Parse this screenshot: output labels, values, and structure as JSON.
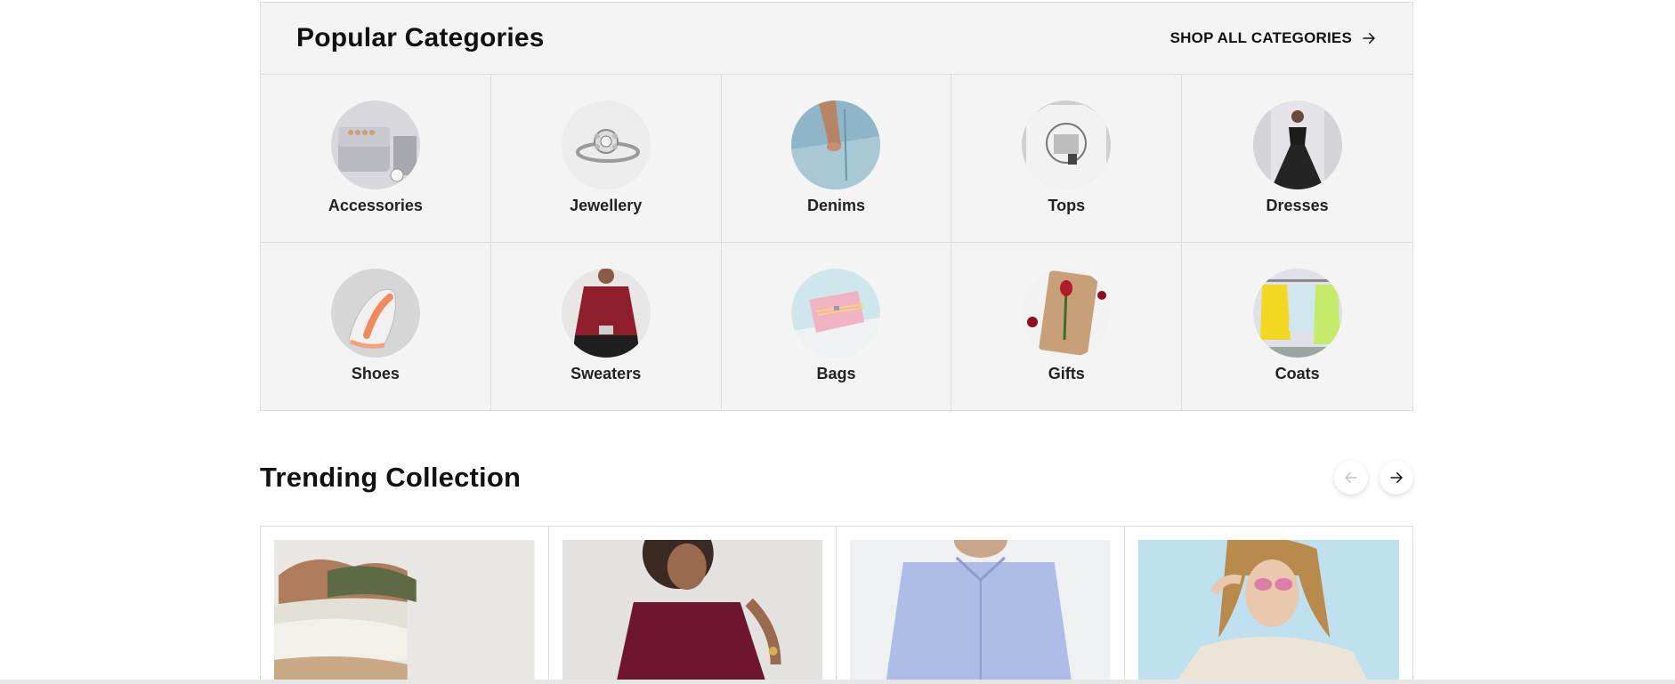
{
  "popular": {
    "title": "Popular Categories",
    "shop_all": "SHOP ALL CATEGORIES",
    "categories": [
      {
        "label": "Accessories"
      },
      {
        "label": "Jewellery"
      },
      {
        "label": "Denims"
      },
      {
        "label": "Tops"
      },
      {
        "label": "Dresses"
      },
      {
        "label": "Shoes"
      },
      {
        "label": "Sweaters"
      },
      {
        "label": "Bags"
      },
      {
        "label": "Gifts"
      },
      {
        "label": "Coats"
      }
    ]
  },
  "trending": {
    "title": "Trending Collection",
    "prev_icon": "arrow-left-icon",
    "next_icon": "arrow-right-icon"
  },
  "colors": {
    "panel_bg": "#f4f4f4",
    "border": "#dcdcdc",
    "text": "#111111"
  }
}
